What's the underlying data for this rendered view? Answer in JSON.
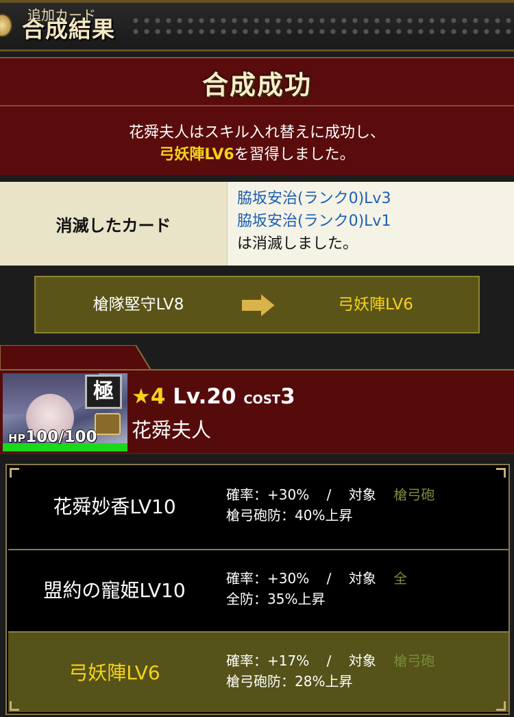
{
  "header": {
    "title": "合成結果"
  },
  "result": {
    "title": "合成成功",
    "line1": "花舜夫人はスキル入れ替えに成功し、",
    "skill_learned": "弓妖陣LV6",
    "line2_suffix": "を習得しました。"
  },
  "destroyed": {
    "label": "消滅したカード",
    "cards": [
      "脇坂安治(ランク0)Lv3",
      "脇坂安治(ランク0)Lv1"
    ],
    "suffix": "は消滅しました。"
  },
  "skill_change": {
    "from": "槍隊堅守LV8",
    "to": "弓妖陣LV6"
  },
  "added_card": {
    "tab_label": "追加カード",
    "rarity_star": "★4",
    "level": "Lv.20",
    "cost_label": "COST",
    "cost": "3",
    "name": "花舜夫人",
    "hp_label": "HP",
    "hp": "100/100",
    "hp_fraction": 1.0,
    "badge": "極",
    "colors": {
      "hp_bar": "#1ad81a",
      "accent": "#f6d21a"
    }
  },
  "skills": [
    {
      "name": "花舜妙香LV10",
      "rate_label": "確率：",
      "rate": "+30%",
      "sep": "/",
      "target_label": "対象",
      "target": "槍弓砲",
      "effect": "槍弓砲防：40%上昇"
    },
    {
      "name": "盟約の寵姫LV10",
      "rate_label": "確率：",
      "rate": "+30%",
      "sep": "/",
      "target_label": "対象",
      "target": "全",
      "effect": "全防：35%上昇"
    },
    {
      "name": "弓妖陣LV6",
      "rate_label": "確率：",
      "rate": "+17%",
      "sep": "/",
      "target_label": "対象",
      "target": "槍弓砲",
      "effect": "槍弓砲防：28%上昇"
    }
  ]
}
